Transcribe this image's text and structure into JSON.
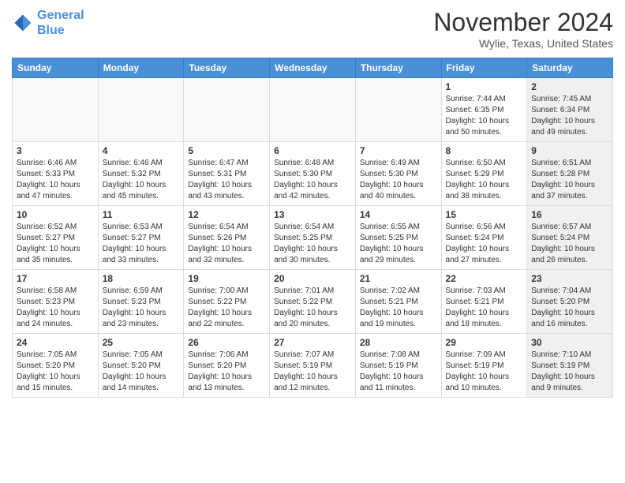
{
  "header": {
    "logo_line1": "General",
    "logo_line2": "Blue",
    "month": "November 2024",
    "location": "Wylie, Texas, United States"
  },
  "weekdays": [
    "Sunday",
    "Monday",
    "Tuesday",
    "Wednesday",
    "Thursday",
    "Friday",
    "Saturday"
  ],
  "weeks": [
    [
      {
        "day": "",
        "empty": true
      },
      {
        "day": "",
        "empty": true
      },
      {
        "day": "",
        "empty": true
      },
      {
        "day": "",
        "empty": true
      },
      {
        "day": "",
        "empty": true
      },
      {
        "day": "1",
        "info": "Sunrise: 7:44 AM\nSunset: 6:35 PM\nDaylight: 10 hours\nand 50 minutes.",
        "shaded": false
      },
      {
        "day": "2",
        "info": "Sunrise: 7:45 AM\nSunset: 6:34 PM\nDaylight: 10 hours\nand 49 minutes.",
        "shaded": true
      }
    ],
    [
      {
        "day": "3",
        "info": "Sunrise: 6:46 AM\nSunset: 5:33 PM\nDaylight: 10 hours\nand 47 minutes.",
        "shaded": false
      },
      {
        "day": "4",
        "info": "Sunrise: 6:46 AM\nSunset: 5:32 PM\nDaylight: 10 hours\nand 45 minutes.",
        "shaded": false
      },
      {
        "day": "5",
        "info": "Sunrise: 6:47 AM\nSunset: 5:31 PM\nDaylight: 10 hours\nand 43 minutes.",
        "shaded": false
      },
      {
        "day": "6",
        "info": "Sunrise: 6:48 AM\nSunset: 5:30 PM\nDaylight: 10 hours\nand 42 minutes.",
        "shaded": false
      },
      {
        "day": "7",
        "info": "Sunrise: 6:49 AM\nSunset: 5:30 PM\nDaylight: 10 hours\nand 40 minutes.",
        "shaded": false
      },
      {
        "day": "8",
        "info": "Sunrise: 6:50 AM\nSunset: 5:29 PM\nDaylight: 10 hours\nand 38 minutes.",
        "shaded": false
      },
      {
        "day": "9",
        "info": "Sunrise: 6:51 AM\nSunset: 5:28 PM\nDaylight: 10 hours\nand 37 minutes.",
        "shaded": true
      }
    ],
    [
      {
        "day": "10",
        "info": "Sunrise: 6:52 AM\nSunset: 5:27 PM\nDaylight: 10 hours\nand 35 minutes.",
        "shaded": false
      },
      {
        "day": "11",
        "info": "Sunrise: 6:53 AM\nSunset: 5:27 PM\nDaylight: 10 hours\nand 33 minutes.",
        "shaded": false
      },
      {
        "day": "12",
        "info": "Sunrise: 6:54 AM\nSunset: 5:26 PM\nDaylight: 10 hours\nand 32 minutes.",
        "shaded": false
      },
      {
        "day": "13",
        "info": "Sunrise: 6:54 AM\nSunset: 5:25 PM\nDaylight: 10 hours\nand 30 minutes.",
        "shaded": false
      },
      {
        "day": "14",
        "info": "Sunrise: 6:55 AM\nSunset: 5:25 PM\nDaylight: 10 hours\nand 29 minutes.",
        "shaded": false
      },
      {
        "day": "15",
        "info": "Sunrise: 6:56 AM\nSunset: 5:24 PM\nDaylight: 10 hours\nand 27 minutes.",
        "shaded": false
      },
      {
        "day": "16",
        "info": "Sunrise: 6:57 AM\nSunset: 5:24 PM\nDaylight: 10 hours\nand 26 minutes.",
        "shaded": true
      }
    ],
    [
      {
        "day": "17",
        "info": "Sunrise: 6:58 AM\nSunset: 5:23 PM\nDaylight: 10 hours\nand 24 minutes.",
        "shaded": false
      },
      {
        "day": "18",
        "info": "Sunrise: 6:59 AM\nSunset: 5:23 PM\nDaylight: 10 hours\nand 23 minutes.",
        "shaded": false
      },
      {
        "day": "19",
        "info": "Sunrise: 7:00 AM\nSunset: 5:22 PM\nDaylight: 10 hours\nand 22 minutes.",
        "shaded": false
      },
      {
        "day": "20",
        "info": "Sunrise: 7:01 AM\nSunset: 5:22 PM\nDaylight: 10 hours\nand 20 minutes.",
        "shaded": false
      },
      {
        "day": "21",
        "info": "Sunrise: 7:02 AM\nSunset: 5:21 PM\nDaylight: 10 hours\nand 19 minutes.",
        "shaded": false
      },
      {
        "day": "22",
        "info": "Sunrise: 7:03 AM\nSunset: 5:21 PM\nDaylight: 10 hours\nand 18 minutes.",
        "shaded": false
      },
      {
        "day": "23",
        "info": "Sunrise: 7:04 AM\nSunset: 5:20 PM\nDaylight: 10 hours\nand 16 minutes.",
        "shaded": true
      }
    ],
    [
      {
        "day": "24",
        "info": "Sunrise: 7:05 AM\nSunset: 5:20 PM\nDaylight: 10 hours\nand 15 minutes.",
        "shaded": false
      },
      {
        "day": "25",
        "info": "Sunrise: 7:05 AM\nSunset: 5:20 PM\nDaylight: 10 hours\nand 14 minutes.",
        "shaded": false
      },
      {
        "day": "26",
        "info": "Sunrise: 7:06 AM\nSunset: 5:20 PM\nDaylight: 10 hours\nand 13 minutes.",
        "shaded": false
      },
      {
        "day": "27",
        "info": "Sunrise: 7:07 AM\nSunset: 5:19 PM\nDaylight: 10 hours\nand 12 minutes.",
        "shaded": false
      },
      {
        "day": "28",
        "info": "Sunrise: 7:08 AM\nSunset: 5:19 PM\nDaylight: 10 hours\nand 11 minutes.",
        "shaded": false
      },
      {
        "day": "29",
        "info": "Sunrise: 7:09 AM\nSunset: 5:19 PM\nDaylight: 10 hours\nand 10 minutes.",
        "shaded": false
      },
      {
        "day": "30",
        "info": "Sunrise: 7:10 AM\nSunset: 5:19 PM\nDaylight: 10 hours\nand 9 minutes.",
        "shaded": true
      }
    ]
  ]
}
